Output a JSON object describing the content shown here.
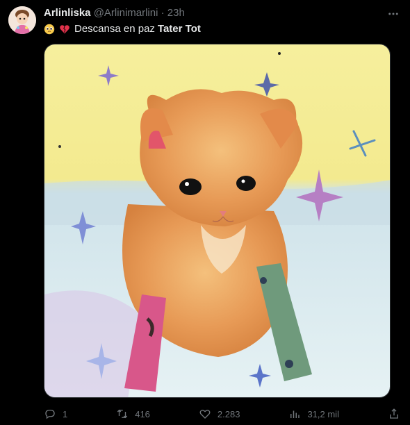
{
  "post": {
    "author_name": "Arlinliska",
    "author_handle": "@Arlinimarlini",
    "separator": "·",
    "time": "23h",
    "text_prefix": "Descansa en paz",
    "text_bold": "Tater Tot",
    "emojis": [
      "pleading-face",
      "broken-heart"
    ]
  },
  "media": {
    "subject": "cat-painting"
  },
  "actions": {
    "replies": "1",
    "reposts": "416",
    "likes": "2.283",
    "views": "31,2 mil"
  },
  "colors": {
    "background": "#000000",
    "text": "#e7e9ea",
    "secondary": "#71767b"
  }
}
